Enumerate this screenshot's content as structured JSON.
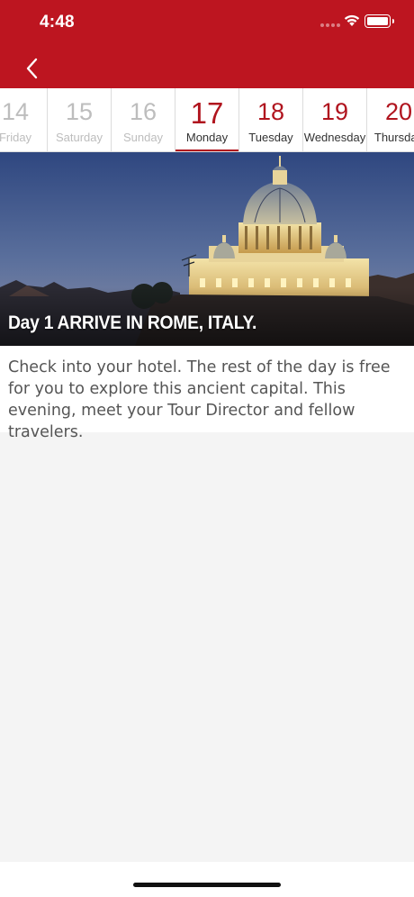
{
  "status_bar": {
    "time": "4:48"
  },
  "nav": {
    "back_icon": "chevron-left-icon"
  },
  "days": [
    {
      "number": "14",
      "name": "Friday",
      "state": "past"
    },
    {
      "number": "15",
      "name": "Saturday",
      "state": "past"
    },
    {
      "number": "16",
      "name": "Sunday",
      "state": "past"
    },
    {
      "number": "17",
      "name": "Monday",
      "state": "active"
    },
    {
      "number": "18",
      "name": "Tuesday",
      "state": "future"
    },
    {
      "number": "19",
      "name": "Wednesday",
      "state": "future"
    },
    {
      "number": "20",
      "name": "Thursday",
      "state": "future"
    }
  ],
  "hero": {
    "title": "Day 1 ARRIVE IN ROME, ITALY."
  },
  "description": "Check into your hotel. The rest of the day is free for you to explore this ancient capital. This evening, meet your Tour Director and fellow travelers.",
  "colors": {
    "brand_red": "#bd1520",
    "accent_red": "#b0141e"
  }
}
